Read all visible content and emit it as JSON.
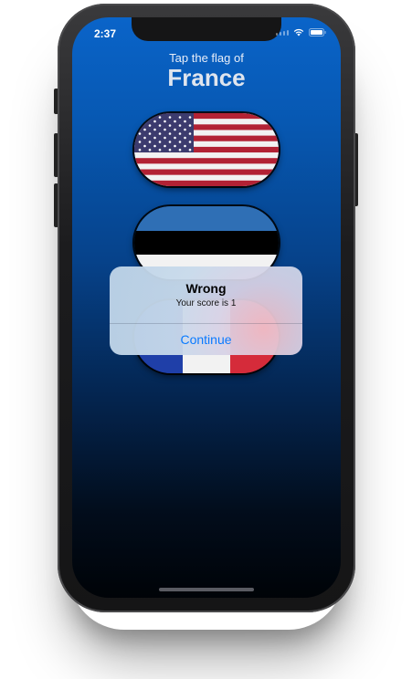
{
  "status_bar": {
    "time": "2:37",
    "icons": [
      "signal-icon",
      "wifi-icon",
      "battery-icon"
    ]
  },
  "header": {
    "prompt": "Tap the flag of",
    "country": "France"
  },
  "flags": [
    {
      "country": "United States",
      "icon": "us-flag"
    },
    {
      "country": "Estonia",
      "icon": "estonia-flag"
    },
    {
      "country": "France",
      "icon": "france-flag"
    }
  ],
  "alert": {
    "title": "Wrong",
    "message": "Your score is 1",
    "action_label": "Continue",
    "action_color": "#0a7aff"
  },
  "colors": {
    "background_top": "#0a64c9",
    "background_bottom": "#000307"
  }
}
